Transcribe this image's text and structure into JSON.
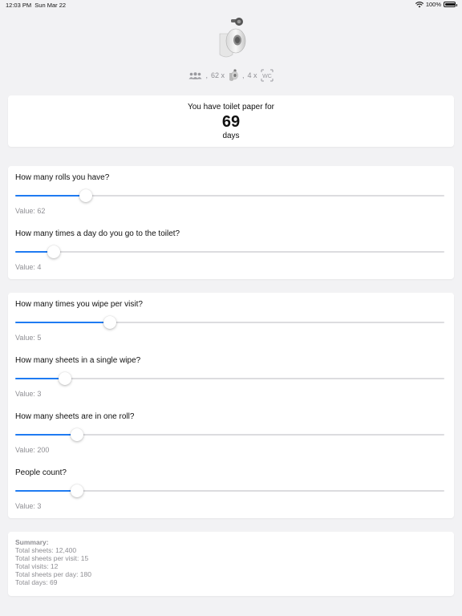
{
  "status_bar": {
    "time": "12:03 PM",
    "date": "Sun Mar 22",
    "battery": "100%",
    "battery_level": 1.0
  },
  "summary_line": {
    "people_sep": ",",
    "rolls": "62 x",
    "visits_sep": ",",
    "visits": "4 x",
    "wc_label": "WC"
  },
  "result": {
    "label": "You have toilet paper for",
    "value": "69",
    "unit": "days"
  },
  "sliders_group1": [
    {
      "question": "How many rolls you have?",
      "value_label": "Value: 62",
      "fraction": 0.165
    },
    {
      "question": "How many times a day do you go to the toilet?",
      "value_label": "Value: 4",
      "fraction": 0.09
    }
  ],
  "sliders_group2": [
    {
      "question": "How many times you wipe per visit?",
      "value_label": "Value: 5",
      "fraction": 0.22
    },
    {
      "question": "How many sheets in a single wipe?",
      "value_label": "Value: 3",
      "fraction": 0.115
    },
    {
      "question": "How many sheets are in one roll?",
      "value_label": "Value: 200",
      "fraction": 0.143
    },
    {
      "question": "People count?",
      "value_label": "Value: 3",
      "fraction": 0.143
    }
  ],
  "summary": {
    "heading": "Summary:",
    "lines": [
      "Total sheets: 12,400",
      "Total sheets per visit: 15",
      "Total visits: 12",
      "Total sheets per day: 180",
      "Total days: 69"
    ]
  },
  "colors": {
    "accent": "#1f7bf2",
    "background": "#f2f2f4",
    "secondary_text": "#8e8e93"
  },
  "icons": [
    "wifi-icon",
    "battery-icon",
    "toilet-paper-icon",
    "people-icon",
    "toilet-roll-small-icon",
    "wc-sign-icon"
  ]
}
